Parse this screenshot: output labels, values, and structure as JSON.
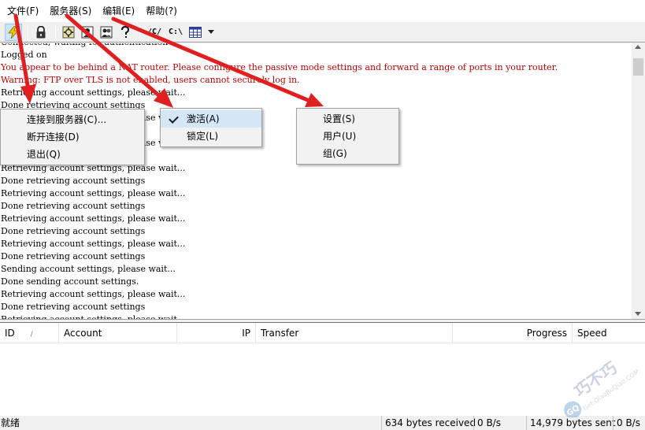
{
  "menubar": {
    "items": [
      {
        "label": "文件(F)"
      },
      {
        "label": "服务器(S)"
      },
      {
        "label": "编辑(E)"
      },
      {
        "label": "帮助(?)"
      }
    ]
  },
  "toolbar": {
    "buttons": [
      {
        "icon": "lightning-icon"
      },
      {
        "icon": "lock-icon"
      },
      {
        "icon": "settings-icon"
      },
      {
        "icon": "users-icon"
      },
      {
        "icon": "groups-icon"
      },
      {
        "icon": "help-icon"
      },
      {
        "icon": "folder-c-icon",
        "label": "/C/"
      },
      {
        "icon": "drive-c-icon",
        "label": "C:\\"
      },
      {
        "icon": "grid-icon"
      },
      {
        "icon": "dropdown-arrow-icon"
      }
    ]
  },
  "log": {
    "lines": [
      {
        "text": "Connected, waiting for authentication",
        "type": "normal"
      },
      {
        "text": "Logged on",
        "type": "normal"
      },
      {
        "text": "You appear to be behind a NAT router. Please configure the passive mode settings and forward a range of ports in your router.",
        "type": "warn"
      },
      {
        "text": "Warning: FTP over TLS is not enabled, users cannot securely log in.",
        "type": "warn"
      },
      {
        "text": "Retrieving account settings, please wait...",
        "type": "normal"
      },
      {
        "text": "Done retrieving account settings",
        "type": "normal"
      },
      {
        "text": "Retrieving account settings, please wait...",
        "type": "normal"
      },
      {
        "text": "Done retrieving account settings",
        "type": "normal"
      },
      {
        "text": "Retrieving account settings, please wait...",
        "type": "normal"
      },
      {
        "text": "Done retrieving account settings",
        "type": "normal"
      },
      {
        "text": "Retrieving account settings, please wait...",
        "type": "normal"
      },
      {
        "text": "Done retrieving account settings",
        "type": "normal"
      },
      {
        "text": "Retrieving account settings, please wait...",
        "type": "normal"
      },
      {
        "text": "Done retrieving account settings",
        "type": "normal"
      },
      {
        "text": "Retrieving account settings, please wait...",
        "type": "normal"
      },
      {
        "text": "Done retrieving account settings",
        "type": "normal"
      },
      {
        "text": "Retrieving account settings, please wait...",
        "type": "normal"
      },
      {
        "text": "Done retrieving account settings",
        "type": "normal"
      },
      {
        "text": "Sending account settings, please wait...",
        "type": "normal"
      },
      {
        "text": "Done sending account settings.",
        "type": "normal"
      },
      {
        "text": "Retrieving account settings, please wait...",
        "type": "normal"
      },
      {
        "text": "Done retrieving account settings",
        "type": "normal"
      },
      {
        "text": "Retrieving account settings, please wait...",
        "type": "normal"
      }
    ]
  },
  "table": {
    "columns": [
      {
        "label": "ID",
        "sort": "/"
      },
      {
        "label": "Account"
      },
      {
        "label": "IP"
      },
      {
        "label": "Transfer"
      },
      {
        "label": "Progress"
      },
      {
        "label": "Speed"
      }
    ]
  },
  "status": {
    "ready": "就绪",
    "received": "634 bytes received",
    "recv_speed": "0 B/s",
    "sent": "14,979 bytes sent",
    "send_speed": "0 B/s"
  },
  "menus": {
    "file": [
      {
        "label": "连接到服务器(C)..."
      },
      {
        "label": "断开连接(D)"
      },
      {
        "label": "退出(Q)"
      }
    ],
    "server": [
      {
        "label": "激活(A)",
        "checked": true
      },
      {
        "label": "锁定(L)",
        "checked": false
      }
    ],
    "edit": [
      {
        "label": "设置(S)"
      },
      {
        "label": "用户(U)"
      },
      {
        "label": "组(G)"
      }
    ]
  },
  "watermark": {
    "text": "巧不巧",
    "url": "Get.QiaoBuQiao.COM",
    "badge": "GQ"
  },
  "colors": {
    "warn": "#c00000",
    "arrow": "#e02020",
    "highlight": "#d5e7f7"
  }
}
